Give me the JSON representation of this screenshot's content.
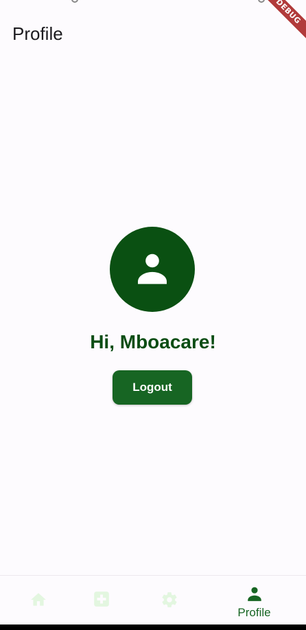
{
  "app_bar": {
    "title": "Profile"
  },
  "debug_banner": {
    "label": "DEBUG"
  },
  "profile": {
    "greeting": "Hi, Mboacare!",
    "avatar_icon": "person-icon",
    "logout_label": "Logout"
  },
  "bottom_nav": {
    "items": [
      {
        "icon": "home-icon",
        "label": ""
      },
      {
        "icon": "medical-add-icon",
        "label": ""
      },
      {
        "icon": "settings-icon",
        "label": ""
      },
      {
        "icon": "person-icon",
        "label": "Profile"
      }
    ],
    "selected_index": 3
  },
  "colors": {
    "primary": "#176523",
    "primary_dark": "#0a5012",
    "greeting_text": "#0b4d14",
    "inactive_icon": "#e3f6e0",
    "background": "#fdfbfe",
    "debug_banner": "#b13b3b"
  }
}
